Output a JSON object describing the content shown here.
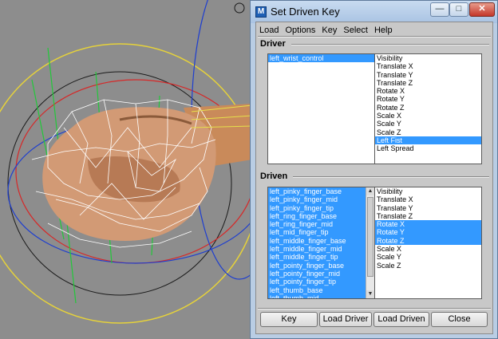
{
  "window": {
    "title": "Set Driven Key",
    "min_glyph": "—",
    "max_glyph": "□",
    "close_glyph": "✕",
    "app_glyph": "M"
  },
  "menu": [
    "Load",
    "Options",
    "Key",
    "Select",
    "Help"
  ],
  "driver": {
    "title": "Driver",
    "objects": [
      {
        "label": "left_wrist_control",
        "selected": true
      }
    ],
    "attributes": [
      {
        "label": "Visibility",
        "selected": false
      },
      {
        "label": "Translate X",
        "selected": false
      },
      {
        "label": "Translate Y",
        "selected": false
      },
      {
        "label": "Translate Z",
        "selected": false
      },
      {
        "label": "Rotate X",
        "selected": false
      },
      {
        "label": "Rotate Y",
        "selected": false
      },
      {
        "label": "Rotate Z",
        "selected": false
      },
      {
        "label": "Scale X",
        "selected": false
      },
      {
        "label": "Scale Y",
        "selected": false
      },
      {
        "label": "Scale Z",
        "selected": false
      },
      {
        "label": "Left Fist",
        "selected": true
      },
      {
        "label": "Left Spread",
        "selected": false
      }
    ]
  },
  "driven": {
    "title": "Driven",
    "objects": [
      {
        "label": "left_pinky_finger_base",
        "selected": true
      },
      {
        "label": "left_pinky_finger_mid",
        "selected": true
      },
      {
        "label": "left_pinky_finger_tip",
        "selected": true
      },
      {
        "label": "left_ring_finger_base",
        "selected": true
      },
      {
        "label": "left_ring_finger_mid",
        "selected": true
      },
      {
        "label": "left_mid_finger_tip",
        "selected": true
      },
      {
        "label": "left_middle_finger_base",
        "selected": true
      },
      {
        "label": "left_middle_finger_mid",
        "selected": true
      },
      {
        "label": "left_middle_finger_tip",
        "selected": true
      },
      {
        "label": "left_pointy_finger_base",
        "selected": true
      },
      {
        "label": "left_pointy_finger_mid",
        "selected": true
      },
      {
        "label": "left_pointy_finger_tip",
        "selected": true
      },
      {
        "label": "left_thumb_base",
        "selected": true
      },
      {
        "label": "left_thumb_mid",
        "selected": true
      }
    ],
    "attributes": [
      {
        "label": "Visibility",
        "selected": false
      },
      {
        "label": "Translate X",
        "selected": false
      },
      {
        "label": "Translate Y",
        "selected": false
      },
      {
        "label": "Translate Z",
        "selected": false
      },
      {
        "label": "Rotate X",
        "selected": true
      },
      {
        "label": "Rotate Y",
        "selected": true
      },
      {
        "label": "Rotate Z",
        "selected": true
      },
      {
        "label": "Scale X",
        "selected": false
      },
      {
        "label": "Scale Y",
        "selected": false
      },
      {
        "label": "Scale Z",
        "selected": false
      }
    ],
    "scroll_up_glyph": "▲",
    "scroll_down_glyph": "▼"
  },
  "buttons": {
    "key": "Key",
    "load_driver": "Load Driver",
    "load_driven": "Load Driven",
    "close": "Close"
  },
  "colors": {
    "selection": "#3399ff",
    "panel": "#c8c8c8",
    "frame": "#b9cde4"
  }
}
